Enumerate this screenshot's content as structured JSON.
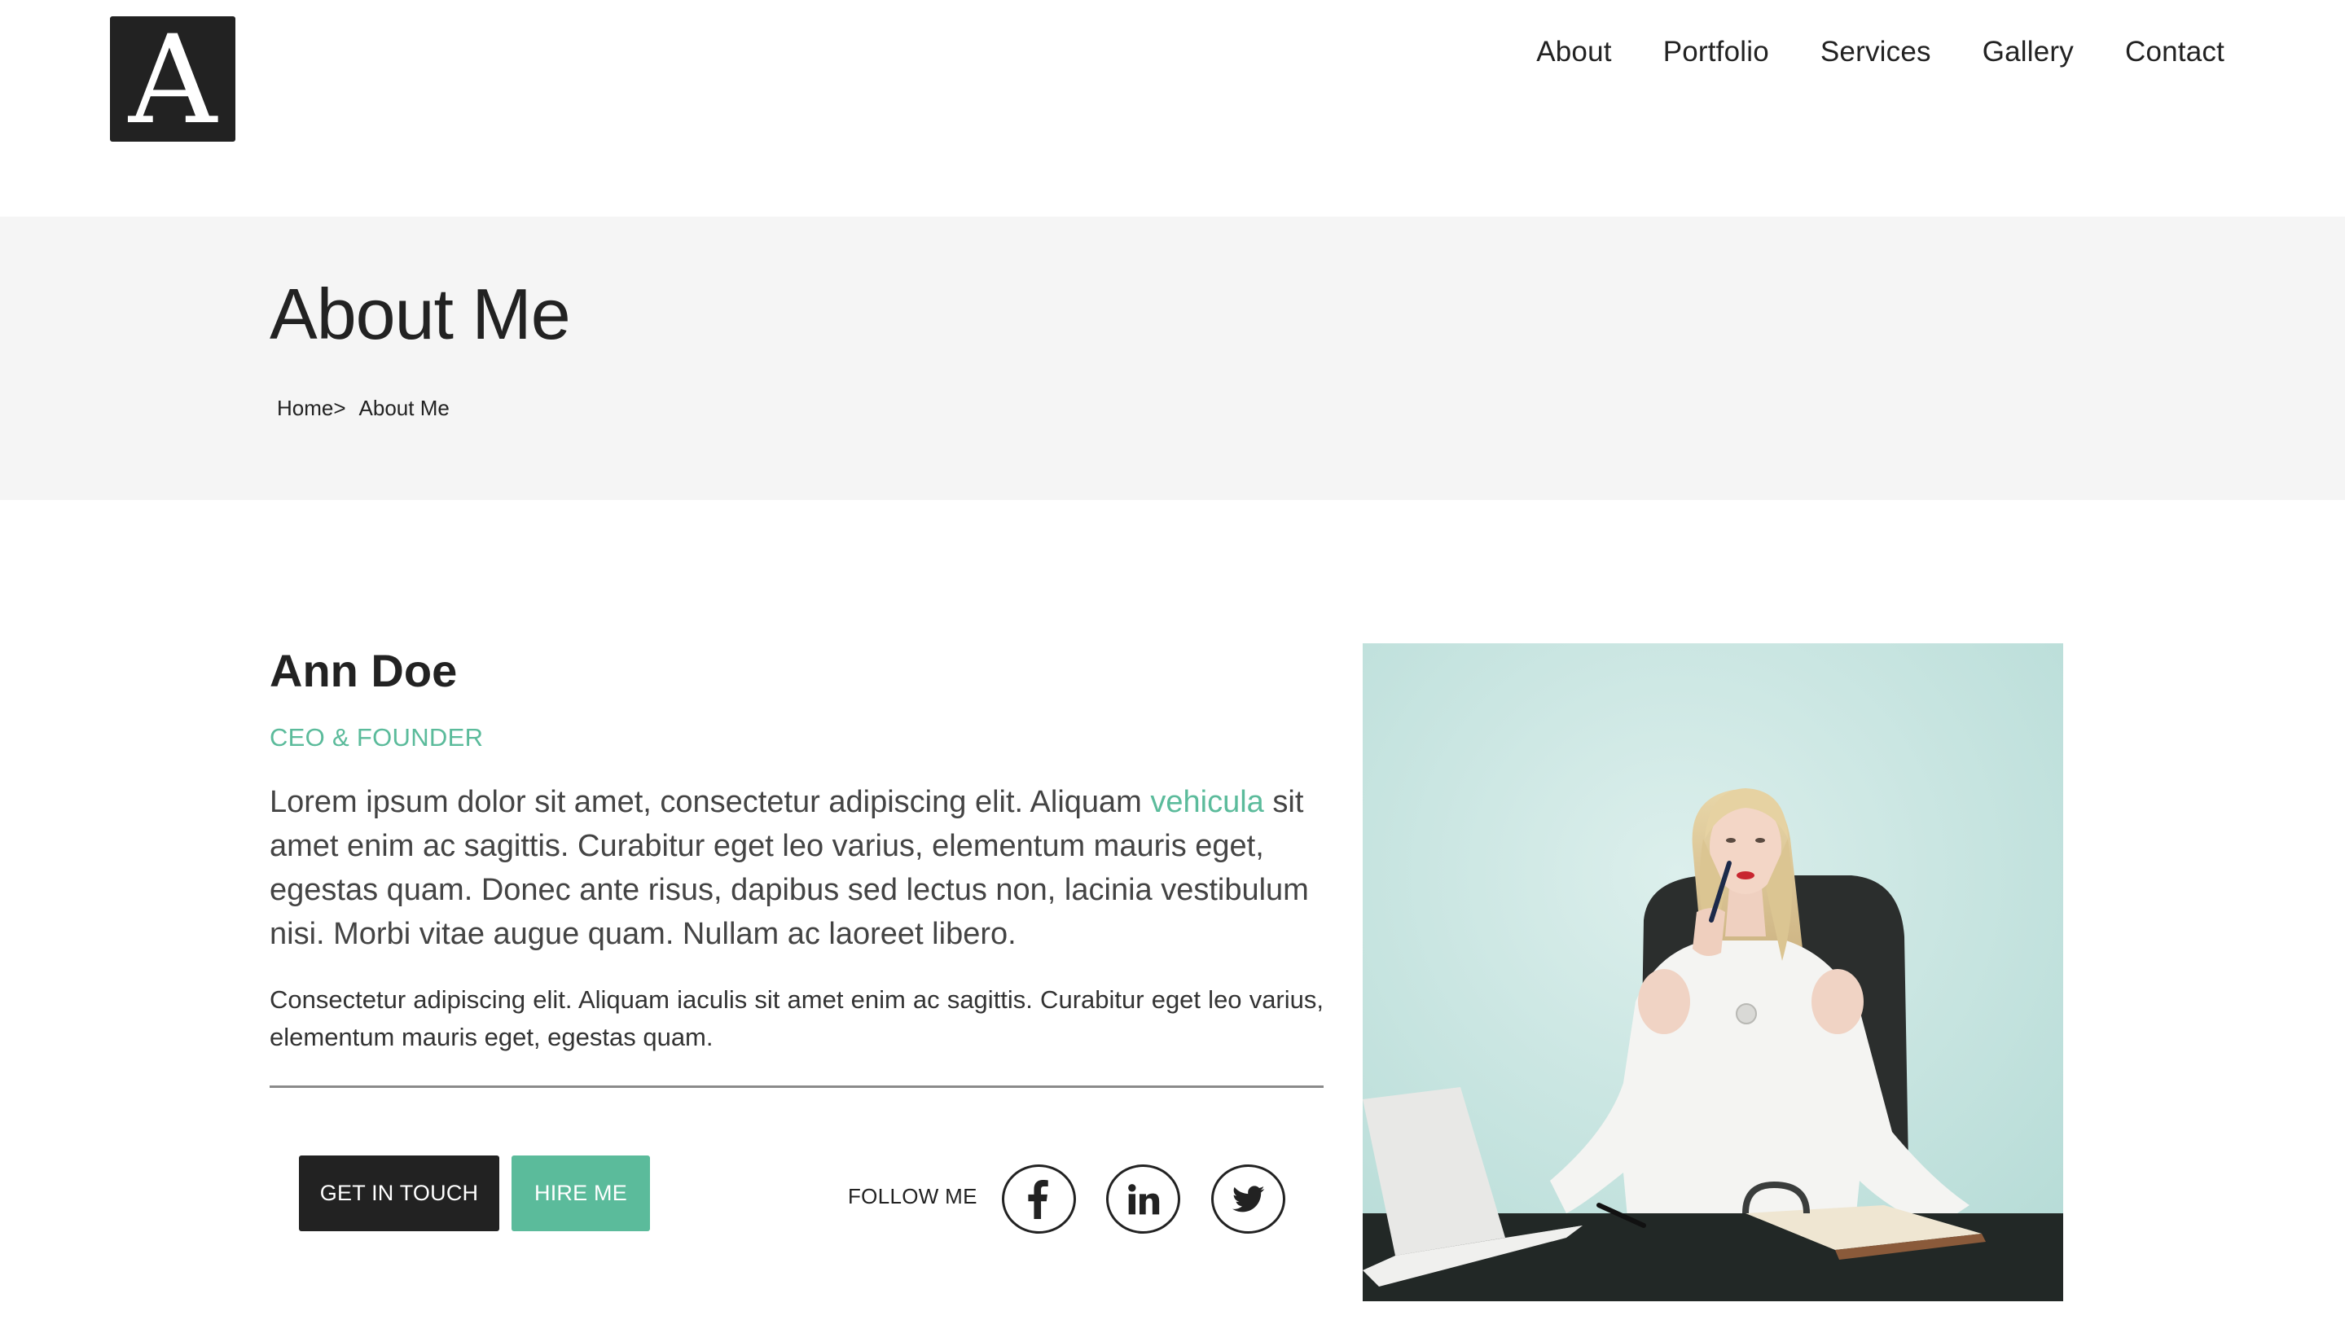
{
  "header": {
    "logo_letter": "A",
    "nav": [
      "About",
      "Portfolio",
      "Services",
      "Gallery",
      "Contact"
    ]
  },
  "banner": {
    "title": "About Me",
    "breadcrumb": {
      "home": "Home>",
      "current": "About Me"
    }
  },
  "profile": {
    "name": "Ann Doe",
    "role": "CEO & FOUNDER",
    "lead_before": "Lorem ipsum dolor sit amet, consectetur adipiscing elit. Aliquam ",
    "lead_highlight": "vehicula",
    "lead_after": " sit amet enim ac sagittis. Curabitur eget leo varius, elementum mauris eget, egestas quam. Donec ante risus, dapibus sed lectus non, lacinia vestibulum nisi. Morbi vitae augue quam. Nullam ac laoreet libero.",
    "body": "Consectetur adipiscing elit. Aliquam iaculis sit amet enim ac sagittis. Curabitur eget leo varius, elementum mauris eget, egestas quam."
  },
  "actions": {
    "get_in_touch": "GET IN TOUCH",
    "hire_me": "HIRE ME",
    "follow_label": "FOLLOW ME",
    "social_icons": [
      "facebook-icon",
      "linkedin-icon",
      "twitter-icon"
    ]
  },
  "colors": {
    "accent": "#5bbb9b",
    "dark": "#222222",
    "banner_bg": "#f5f5f5"
  }
}
